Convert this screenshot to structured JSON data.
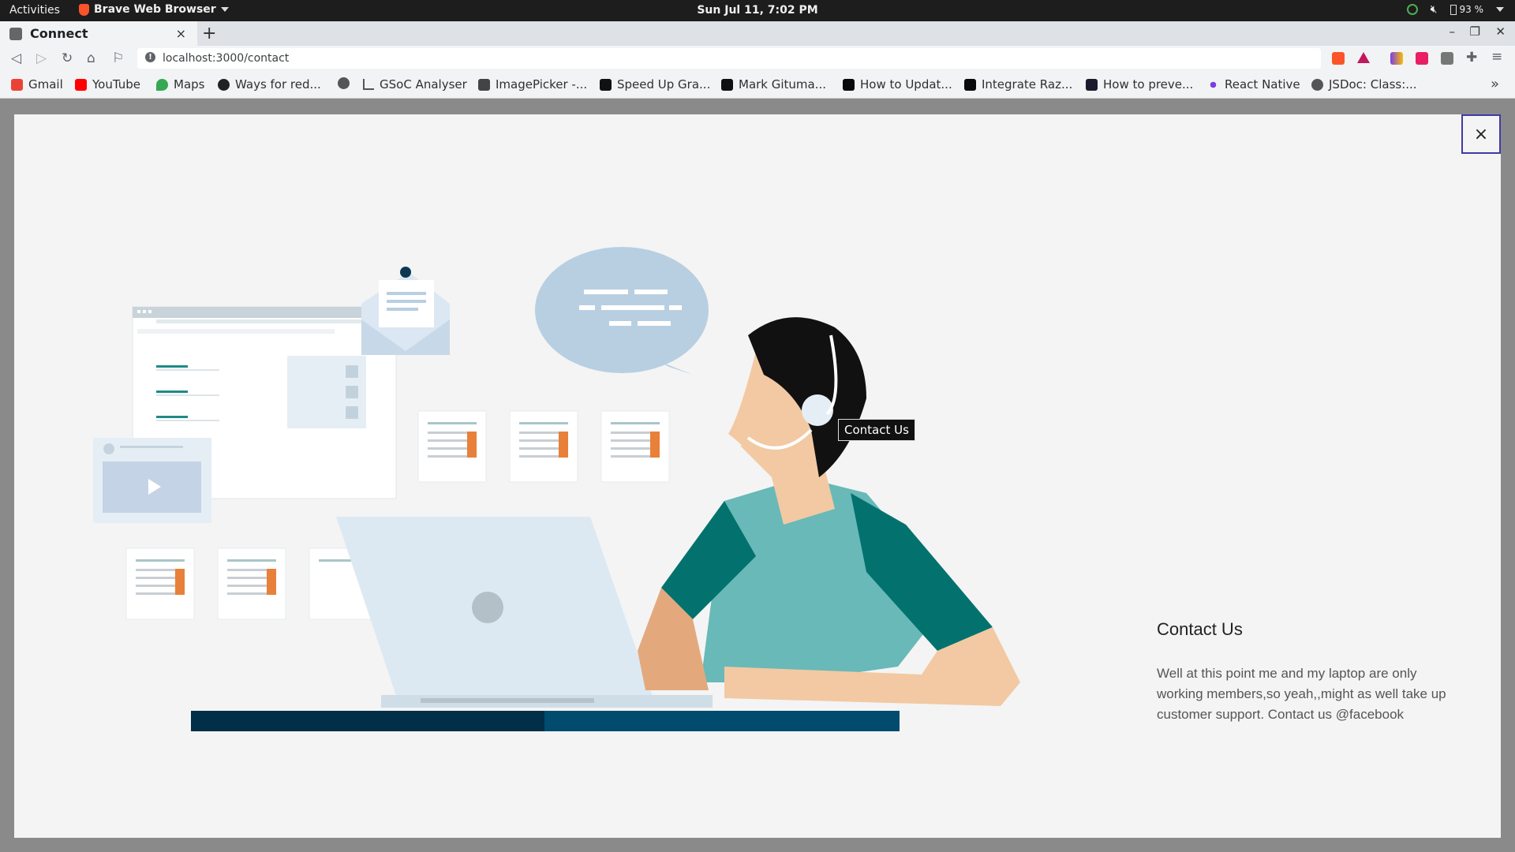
{
  "system_bar": {
    "activities": "Activities",
    "app_name": "Brave Web Browser",
    "clock": "Sun Jul 11,  7:02 PM",
    "battery": "93 %"
  },
  "browser": {
    "tab_title": "Connect",
    "tab_close": "×",
    "new_tab": "+",
    "url": "localhost:3000/contact",
    "window_controls": {
      "minimize": "–",
      "restore": "❐",
      "close": "✕"
    }
  },
  "bookmarks": [
    {
      "label": "Gmail",
      "color": "#ea4335"
    },
    {
      "label": "YouTube",
      "color": "#ff0000"
    },
    {
      "label": "Maps",
      "color": "#34a853"
    },
    {
      "label": "Ways for red...",
      "color": "#222222"
    },
    {
      "label": "",
      "color": "#555555"
    },
    {
      "label": "GSoC Analyser",
      "color": "#555555"
    },
    {
      "label": "ImagePicker -...",
      "color": "#444444"
    },
    {
      "label": "Speed Up Gra...",
      "color": "#111111"
    },
    {
      "label": "Mark Gituma...",
      "color": "#111111"
    },
    {
      "label": "How to Updat...",
      "color": "#0a0a0a"
    },
    {
      "label": "Integrate Raz...",
      "color": "#0a0a0a"
    },
    {
      "label": "How to preve...",
      "color": "#1a1a2e"
    },
    {
      "label": "React Native",
      "color": "#7b3fe4"
    },
    {
      "label": "JSDoc: Class:...",
      "color": "#555555"
    }
  ],
  "bookmarks_more": "»",
  "modal": {
    "close_label": "×",
    "tooltip": "Contact Us",
    "title": "Contact Us",
    "body": "Well at this point me and my laptop are only working members,so yeah,,might as well take up customer support. Contact us @facebook"
  },
  "colors": {
    "teal_shirt": "#68b9b8",
    "dark_teal": "#03726f",
    "skin": "#f2c9a2",
    "bubble": "#b8cfe2",
    "desk_dark": "#002f47",
    "desk_blue": "#004b6e"
  }
}
